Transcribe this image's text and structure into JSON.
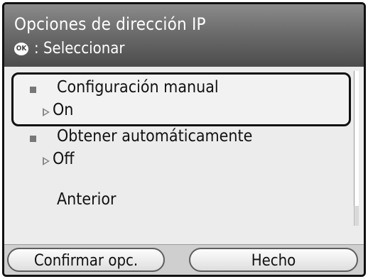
{
  "header": {
    "title": "Opciones de dirección IP",
    "hint_icon": "OK",
    "hint_text": ": Seleccionar"
  },
  "menu": {
    "items": [
      {
        "label": "Configuración manual",
        "value": "On"
      },
      {
        "label": "Obtener automáticamente",
        "value": "Off"
      }
    ],
    "back_label": "Anterior"
  },
  "footer": {
    "left_button": "Confirmar opc.",
    "right_button": "Hecho"
  }
}
